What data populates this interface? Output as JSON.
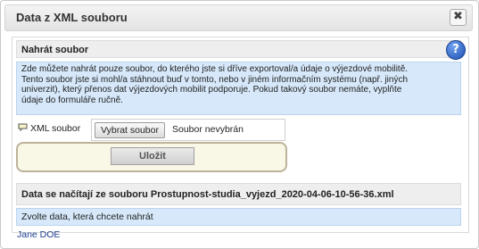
{
  "dialog": {
    "title": "Data z XML souboru",
    "close_label": "✖"
  },
  "upload_section": {
    "header": "Nahrát soubor",
    "help_label": "?",
    "info_line1": "Zde můžete nahrát pouze soubor, do kterého jste si dříve exportoval/a údaje o výjezdové mobilitě.",
    "info_line2": "Tento soubor jste si mohl/a stáhnout buď v tomto, nebo v jiném informačním systému (např. jiných",
    "info_line3": "univerzit), který přenos dat výjezdových mobilit podporuje. Pokud takový soubor nemáte, vyplňte",
    "info_line4": "údaje do formuláře ručně.",
    "file_label": "XML soubor",
    "choose_button": "Vybrat soubor",
    "no_file": "Soubor nevybrán",
    "submit_button": "Uložit"
  },
  "load_section": {
    "header": "Data se načítají ze souboru Prostupnost-studia_vyjezd_2020-04-06-10-56-36.xml",
    "prompt": "Zvolte data, která chcete nahrát"
  },
  "footer": {
    "user": "Jane DOE"
  }
}
